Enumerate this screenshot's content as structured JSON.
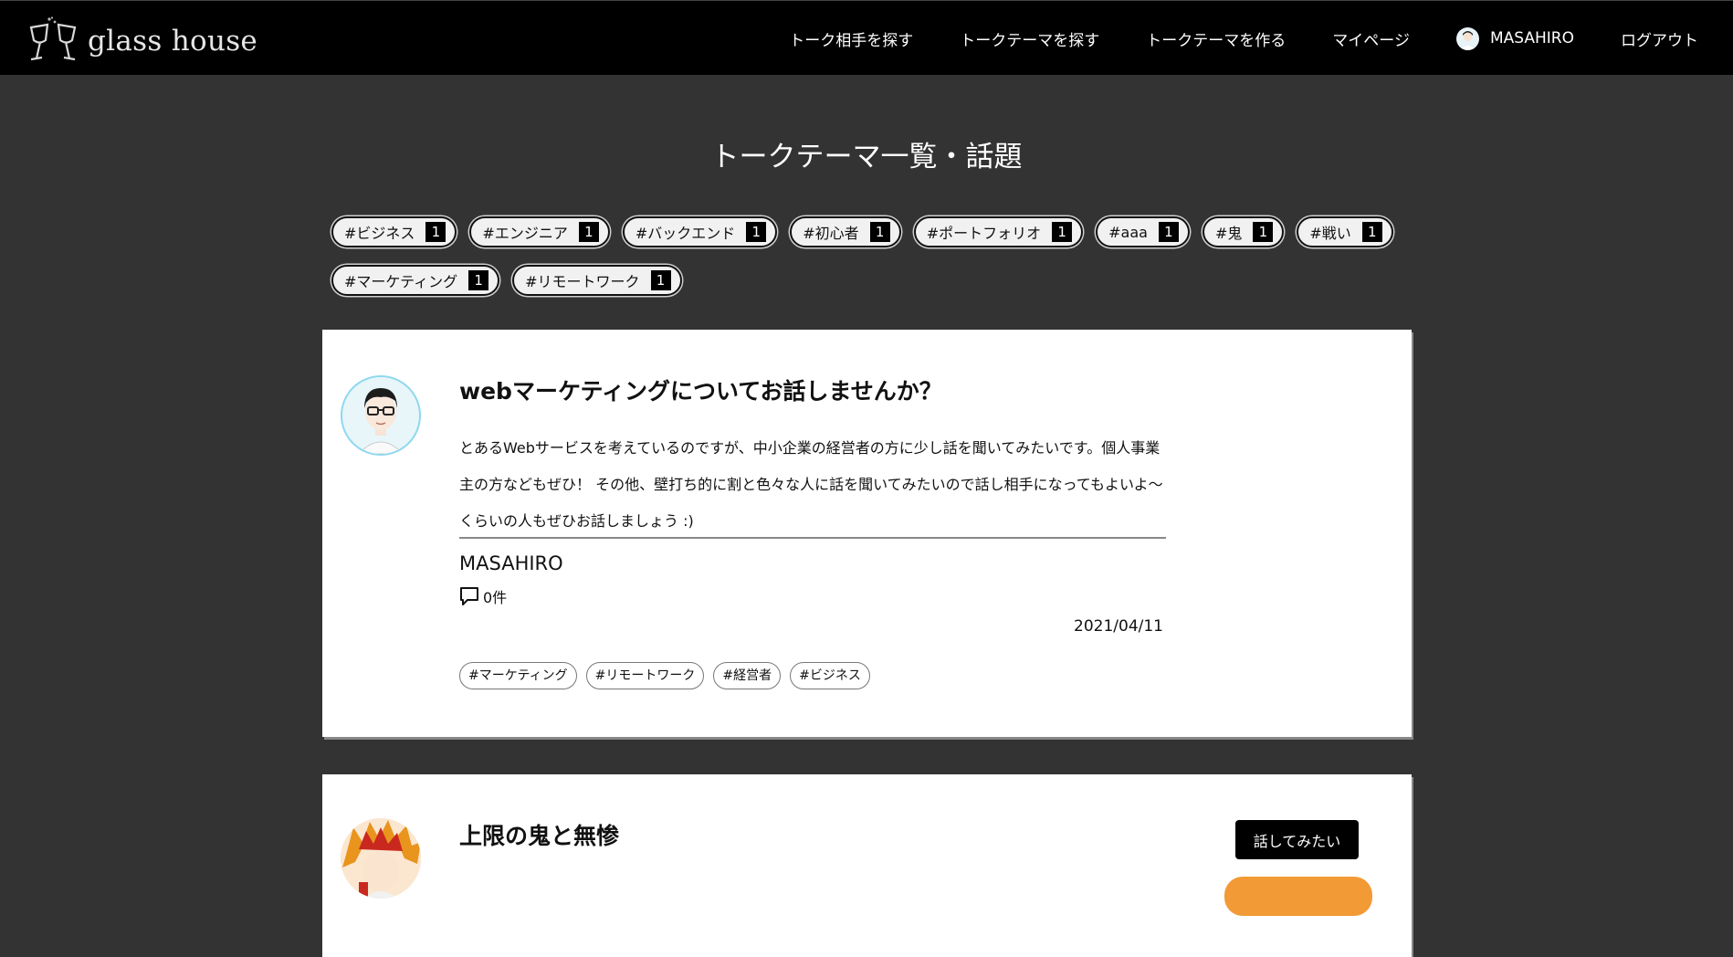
{
  "header": {
    "logo_text": "glass house",
    "nav": [
      {
        "label": "トーク相手を探す"
      },
      {
        "label": "トークテーマを探す"
      },
      {
        "label": "トークテーマを作る"
      },
      {
        "label": "マイページ"
      },
      {
        "label": "MASAHIRO"
      },
      {
        "label": "ログアウト"
      }
    ]
  },
  "page_title": "トークテーマ一覧・話題",
  "tags": [
    {
      "label": "#ビジネス",
      "count": "1"
    },
    {
      "label": "#エンジニア",
      "count": "1"
    },
    {
      "label": "#バックエンド",
      "count": "1"
    },
    {
      "label": "#初心者",
      "count": "1"
    },
    {
      "label": "#ポートフォリオ",
      "count": "1"
    },
    {
      "label": "#aaa",
      "count": "1"
    },
    {
      "label": "#鬼",
      "count": "1"
    },
    {
      "label": "#戦い",
      "count": "1"
    },
    {
      "label": "#マーケティング",
      "count": "1"
    },
    {
      "label": "#リモートワーク",
      "count": "1"
    }
  ],
  "cards": [
    {
      "title": "webマーケティングについてお話しませんか？",
      "body": "とあるWebサービスを考えているのですが、中小企業の経営者の方に少し話を聞いてみたいです。個人事業主の方などもぜひ！ その他、壁打ち的に割と色々な人に話を聞いてみたいので話し相手になってもよいよ〜くらいの人もぜひお話しましょう :)",
      "author": "MASAHIRO",
      "comments": "0件",
      "date": "2021/04/11",
      "tags": [
        "#マーケティング",
        "#リモートワーク",
        "#経営者",
        "#ビジネス"
      ]
    },
    {
      "title": "上限の鬼と無惨",
      "body": "",
      "button_label": "話してみたい"
    }
  ],
  "colors": {
    "background": "#333333",
    "header": "#000000",
    "accent_orange": "#f29a35"
  }
}
